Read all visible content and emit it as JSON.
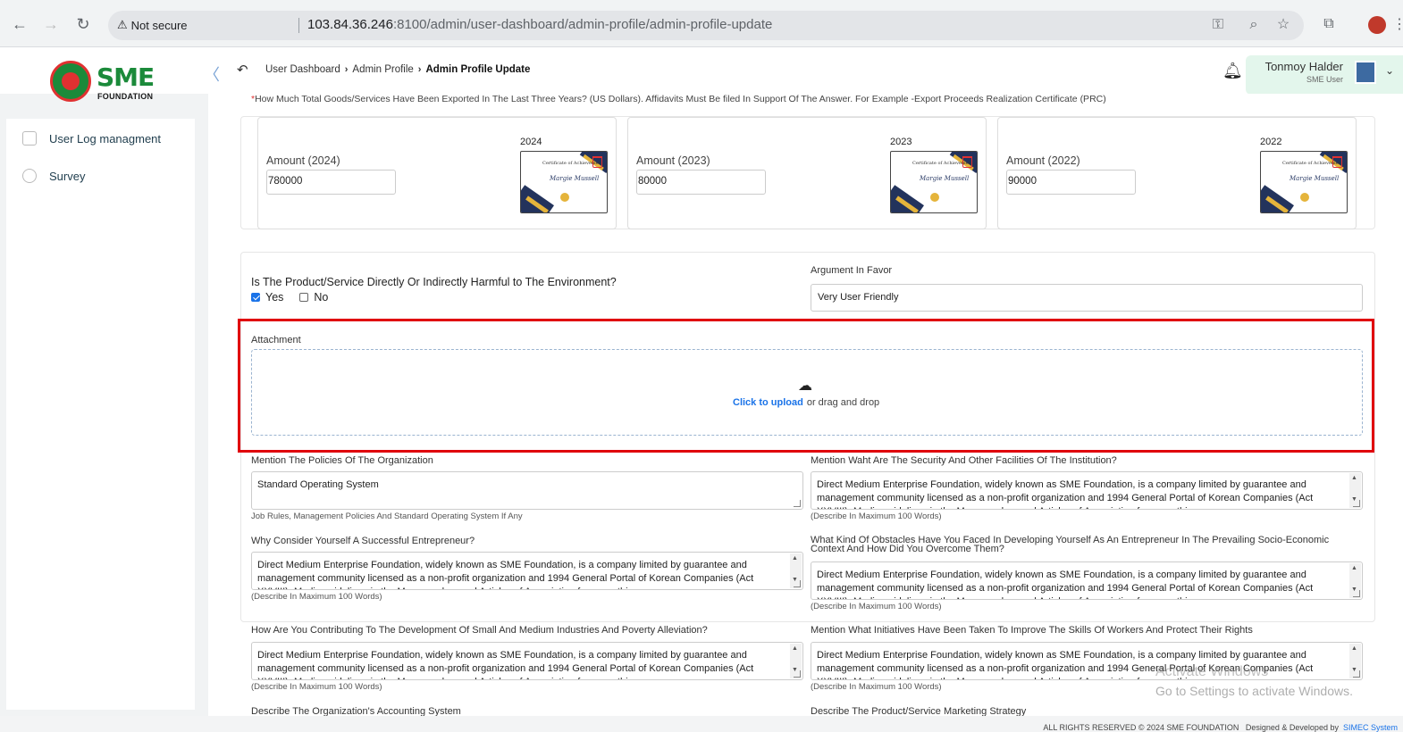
{
  "browser": {
    "security_label": "Not secure",
    "url_host": "103.84.36.246",
    "url_rest": ":8100/admin/user-dashboard/admin-profile/admin-profile-update"
  },
  "header": {
    "logo": {
      "text": "SME",
      "sub": "FOUNDATION"
    },
    "breadcrumb": [
      "User Dashboard",
      "Admin Profile",
      "Admin Profile Update"
    ],
    "user": {
      "name": "Tonmoy Halder",
      "role": "SME User"
    }
  },
  "sidebar": {
    "items": [
      {
        "label": "User Log managment",
        "icon": "log-icon"
      },
      {
        "label": "Survey",
        "icon": "pie-chart-icon"
      }
    ]
  },
  "exports": {
    "question": "How Much Total Goods/Services Have Been Exported In The Last Three Years? (US Dollars). Affidavits Must Be filed In Support Of The Answer. For Example -Export Proceeds Realization Certificate (PRC)",
    "amounts": [
      {
        "label": "Amount (2024)",
        "value": "780000",
        "year": "2024"
      },
      {
        "label": "Amount (2023)",
        "value": "80000",
        "year": "2023"
      },
      {
        "label": "Amount (2022)",
        "value": "90000",
        "year": "2022"
      }
    ],
    "certificate": {
      "title": "Certificate of Achievement",
      "signature": "Margie Mussell"
    }
  },
  "environment": {
    "question": "Is The Product/Service Directly Or Indirectly Harmful to The Environment?",
    "yes_label": "Yes",
    "no_label": "No",
    "selected": "Yes",
    "favor_label": "Argument In Favor",
    "favor_value": "Very User Friendly"
  },
  "attachment": {
    "label": "Attachment",
    "click_text": "Click to upload",
    "drag_text": "or drag and drop"
  },
  "questions": {
    "policies": {
      "label": "Mention The Policies Of The Organization",
      "value": "Standard Operating System",
      "hint": "Job Rules, Management Policies And Standard Operating System If Any"
    },
    "security": {
      "label": "Mention Waht Are The Security And Other Facilities Of The Institution?",
      "hint": "(Describe In Maximum 100 Words)"
    },
    "successful": {
      "label": "Why Consider Yourself A Successful Entrepreneur?",
      "hint": "(Describe In Maximum 100 Words)"
    },
    "obstacles": {
      "label": "What Kind Of Obstacles Have You Faced In Developing Yourself As An Entrepreneur In The Prevailing Socio-Economic Context And How Did You Overcome Them?",
      "label_line1": "What Kind Of Obstacles Have You Faced In Developing Yourself As An Entrepreneur In The Prevailing Socio-Economic",
      "label_line2": "Context And How Did You Overcome Them?",
      "hint": "(Describe In Maximum 100 Words)"
    },
    "contributing": {
      "label": "How Are You Contributing To The Development Of Small And Medium Industries And Poverty Alleviation?",
      "hint": "(Describe In Maximum 100 Words)"
    },
    "initiatives": {
      "label": "Mention What Initiatives Have Been Taken To Improve The Skills Of Workers And Protect Their Rights",
      "hint": "(Describe In Maximum 100 Words)"
    },
    "accounting": {
      "label": "Describe The Organization's Accounting System"
    },
    "marketing": {
      "label": "Describe The Product/Service Marketing Strategy"
    },
    "long_text": "Direct Medium Enterprise Foundation, widely known as SME Foundation, is a company limited by guarantee and management community licensed as a non-profit organization and 1994 General Portal of Korean Companies (Act XXVIII). Media guidelines in the Memorandum and Articles of Association focus on this"
  },
  "watermark": {
    "line1": "Activate Windows",
    "line2": "Go to Settings to activate Windows."
  },
  "footer": {
    "copyright": "ALL RIGHTS RESERVED © 2024 SME FOUNDATION",
    "designed": "Designed & Developed by",
    "company": "SIMEC System"
  },
  "colors": {
    "accent": "#1a73e8",
    "highlight": "#e0000b",
    "brand_green": "#1b8a3a"
  }
}
